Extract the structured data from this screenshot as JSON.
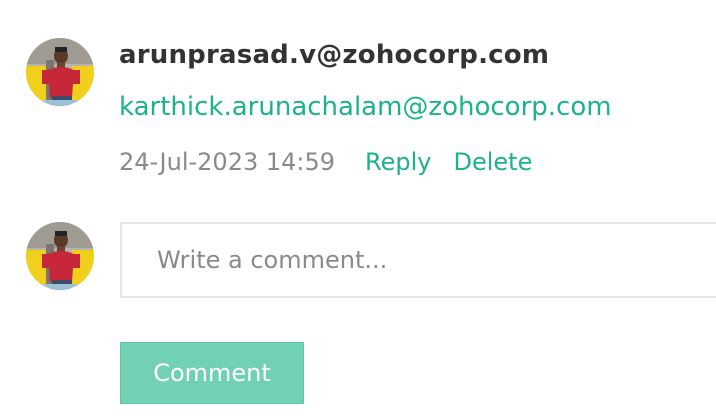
{
  "comment": {
    "author": "arunprasad.v@zohocorp.com",
    "text": "karthick.arunachalam@zohocorp.com",
    "timestamp": "24-Jul-2023 14:59",
    "reply_label": "Reply",
    "delete_label": "Delete"
  },
  "composer": {
    "placeholder": "Write a comment...",
    "value": "",
    "submit_label": "Comment"
  },
  "colors": {
    "accent": "#1db28e",
    "button_bg": "#72d0b5",
    "muted_text": "#8a8a8a",
    "author_text": "#333333"
  },
  "icons": {
    "avatar": "user-avatar-photo"
  }
}
